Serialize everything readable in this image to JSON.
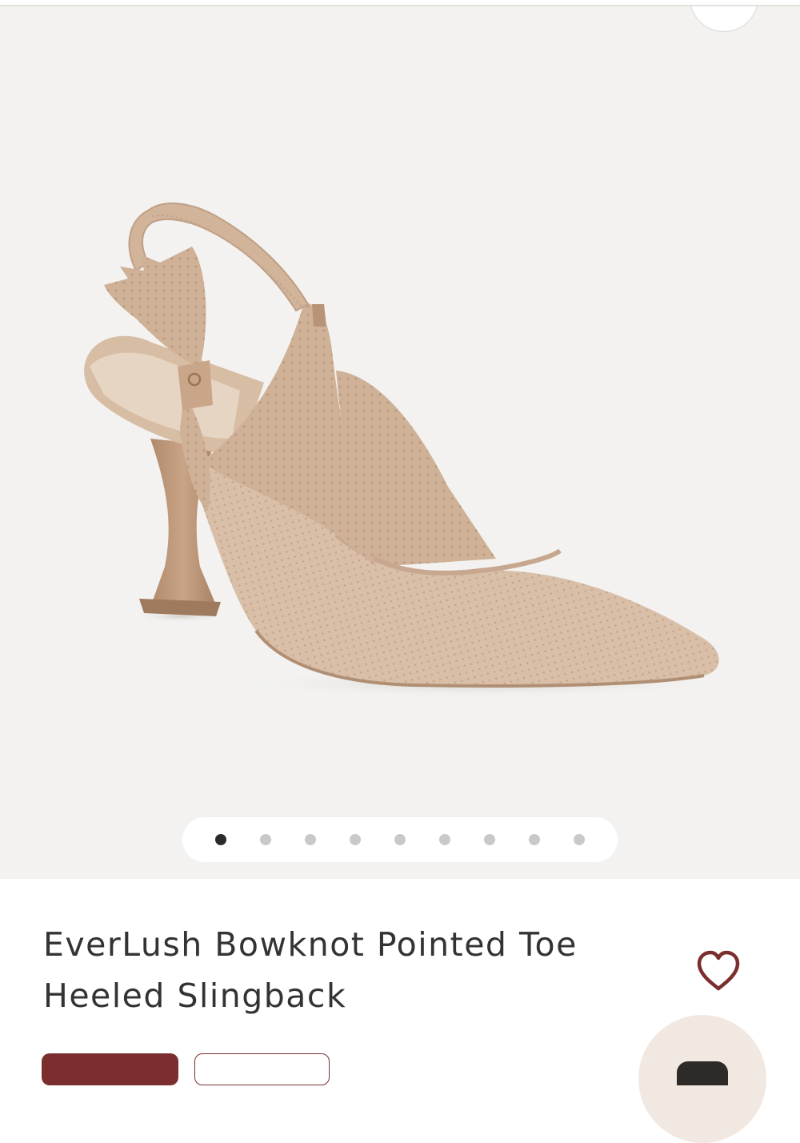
{
  "product": {
    "title_line1": "EverLush Bowknot Pointed Toe",
    "title_line2": "Heeled Slingback",
    "image_alt": "Nude knit pointed toe slingback heel with bow"
  },
  "gallery": {
    "image_count": 9,
    "active_index": 0
  },
  "icons": {
    "favorite": "heart-icon",
    "floating_action": "chat-icon"
  },
  "colors": {
    "accent": "#7b2e2e",
    "gallery_bg": "#f3f2f0",
    "active_dot": "#2b2b2b",
    "inactive_dot": "#c9c9c9",
    "title_text": "#333333"
  }
}
